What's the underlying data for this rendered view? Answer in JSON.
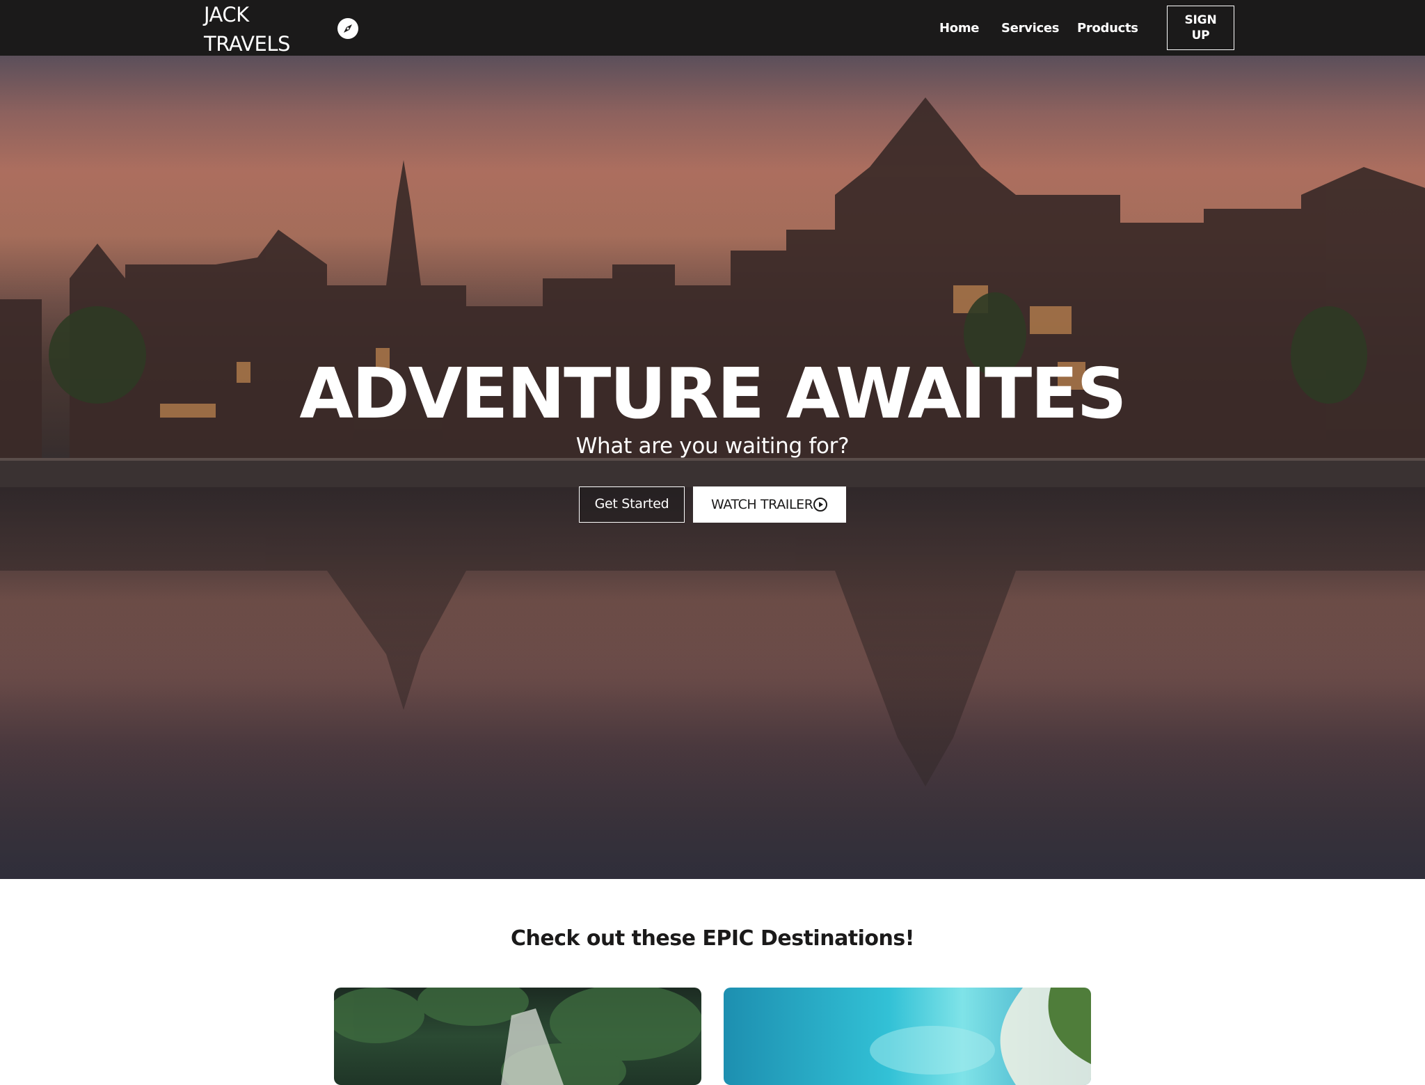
{
  "navbar": {
    "logo_line1": "JACK",
    "logo_line2": "TRAVELS",
    "logo_icon": "compass-icon",
    "links": [
      {
        "label": "Home"
      },
      {
        "label": "Services"
      },
      {
        "label": "Products"
      }
    ],
    "signup_line1": "SIGN",
    "signup_line2": "UP"
  },
  "hero": {
    "title": "ADVENTURE AWAITES",
    "subtitle": "What are you waiting for?",
    "get_started_label": "Get Started",
    "watch_trailer_label": "WATCH TRAILER",
    "watch_trailer_icon": "play-circle-icon",
    "background": "city-canal-sunset-photo"
  },
  "destinations": {
    "heading": "Check out these EPIC Destinations!",
    "cards": [
      {
        "image": "waterfall-jungle-photo"
      },
      {
        "image": "tropical-beach-aerial-photo"
      }
    ]
  },
  "colors": {
    "navbar_bg": "#1b1a1a",
    "text_light": "#ffffff",
    "text_dark": "#1b1a1a"
  }
}
